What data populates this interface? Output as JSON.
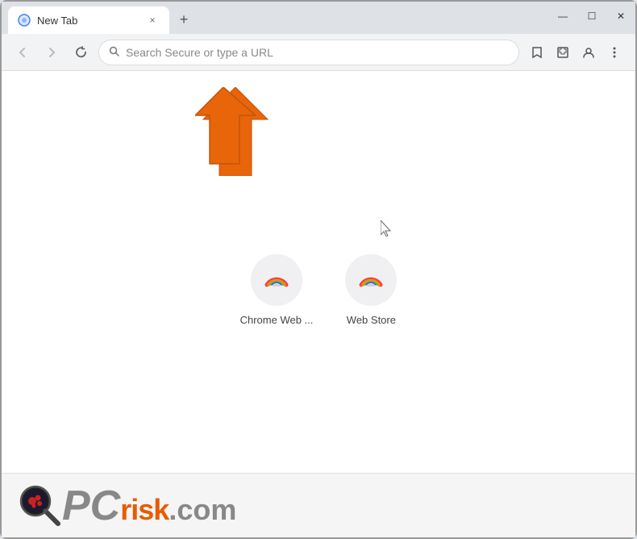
{
  "titleBar": {
    "tab": {
      "title": "New Tab",
      "close_label": "×",
      "new_tab_label": "+"
    },
    "windowControls": {
      "minimize": "—",
      "maximize": "☐",
      "close": "✕"
    }
  },
  "toolbar": {
    "back_tooltip": "Back",
    "forward_tooltip": "Forward",
    "refresh_tooltip": "Reload",
    "addressPlaceholder": "Search Secure or type a URL",
    "bookmark_icon": "☆",
    "extension_icon": "⚡",
    "profile_icon": "👤",
    "menu_icon": "⋮"
  },
  "shortcuts": [
    {
      "label": "Chrome Web ...",
      "id": "chrome-web"
    },
    {
      "label": "Web Store",
      "id": "web-store"
    }
  ],
  "watermark": {
    "pc_letters": "PC",
    "risk_text": "risk",
    "dot_com": ".com"
  },
  "colors": {
    "arrow": "#e8650a",
    "accent": "#e85c00",
    "tab_bg": "#ffffff",
    "toolbar_bg": "#f1f3f4",
    "body_bg": "#dee1e6"
  }
}
